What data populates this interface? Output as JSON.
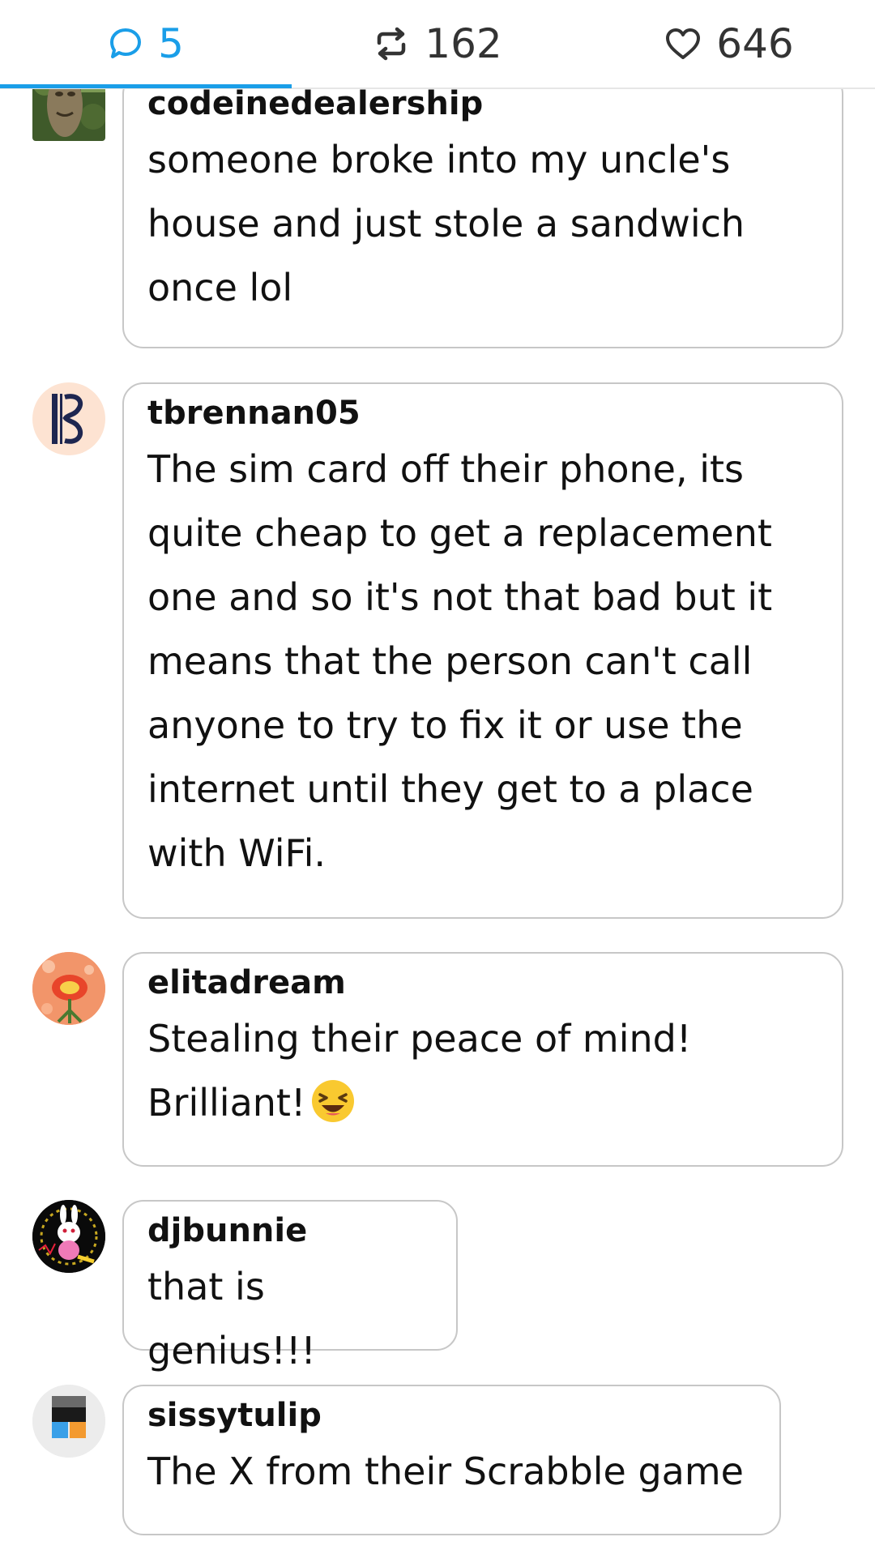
{
  "tabs": {
    "replies_count": "5",
    "reblogs_count": "162",
    "likes_count": "646"
  },
  "colors": {
    "accent": "#1a9ee8",
    "border": "#c7c7c7",
    "text": "#111111"
  },
  "comments": [
    {
      "username": "codeinedealership",
      "lines": [
        "someone broke into my uncle's",
        "house and just stole a sandwich",
        "once lol"
      ],
      "avatar_icon": "wooden-face-avatar"
    },
    {
      "username": "tbrennan05",
      "lines": [
        "The sim card off their phone, its",
        "quite cheap to get a replacement",
        "one and so it's not that bad but it",
        "means that the person can't call",
        "anyone to try to fix it or use the",
        "internet until they get to a place",
        "with WiFi."
      ],
      "avatar_icon": "alto-clef-avatar"
    },
    {
      "username": "elitadream",
      "lines": [
        "Stealing their peace of mind!",
        "Brilliant!"
      ],
      "emoji": "laughing-face-emoji",
      "avatar_icon": "flower-avatar"
    },
    {
      "username": "djbunnie",
      "lines": [
        "that is genius!!!"
      ],
      "avatar_icon": "bunny-avatar"
    },
    {
      "username": "sissytulip",
      "lines": [
        "The X from their Scrabble game"
      ],
      "avatar_icon": "block-figure-avatar"
    }
  ]
}
